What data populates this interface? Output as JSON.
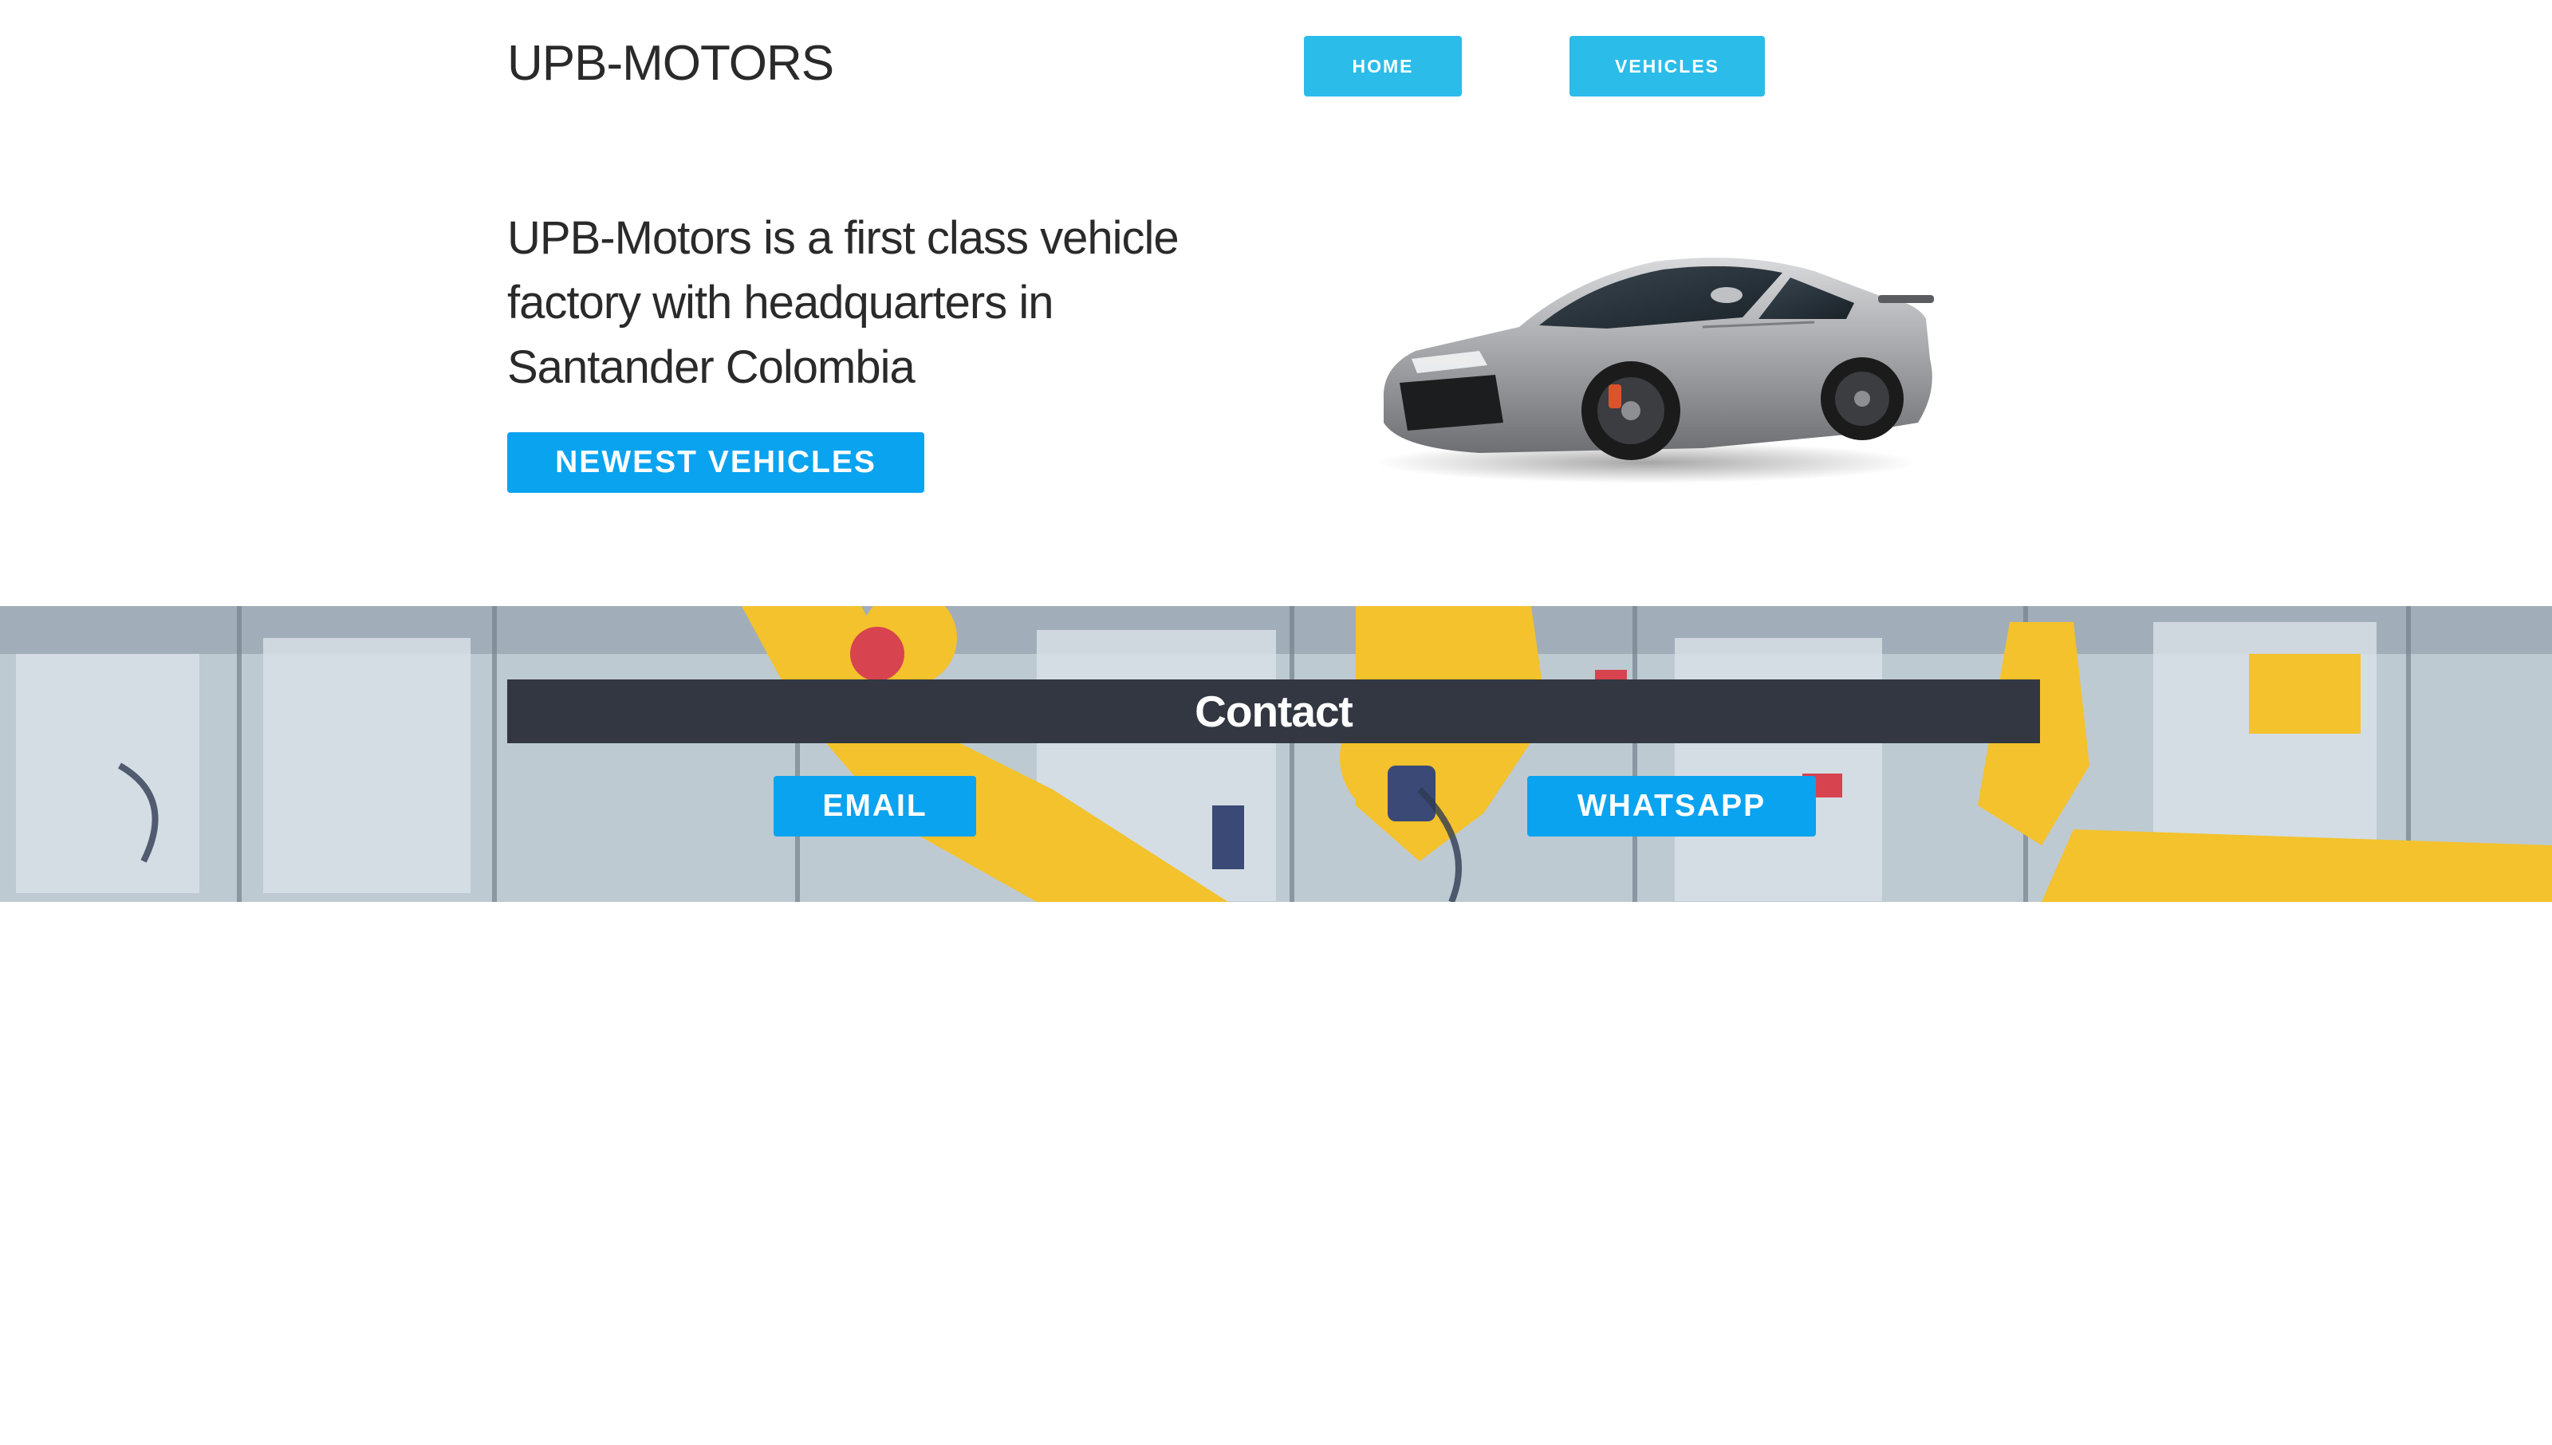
{
  "header": {
    "brand": "UPB-MOTORS",
    "nav": [
      {
        "label": "HOME"
      },
      {
        "label": "VEHICLES"
      }
    ]
  },
  "hero": {
    "headline": "UPB-Motors is a first class vehicle factory with headquarters in Santander Colombia",
    "cta_label": "NEWEST VEHICLES",
    "image": "silver-sports-car"
  },
  "contact": {
    "title": "Contact",
    "background_image": "factory-robot-arms",
    "email_label": "EMAIL",
    "whatsapp_label": "WHATSAPP"
  },
  "colors": {
    "nav_button": "#2bbce9",
    "action_button": "#0aa3f0",
    "contact_bar": "#333742"
  }
}
